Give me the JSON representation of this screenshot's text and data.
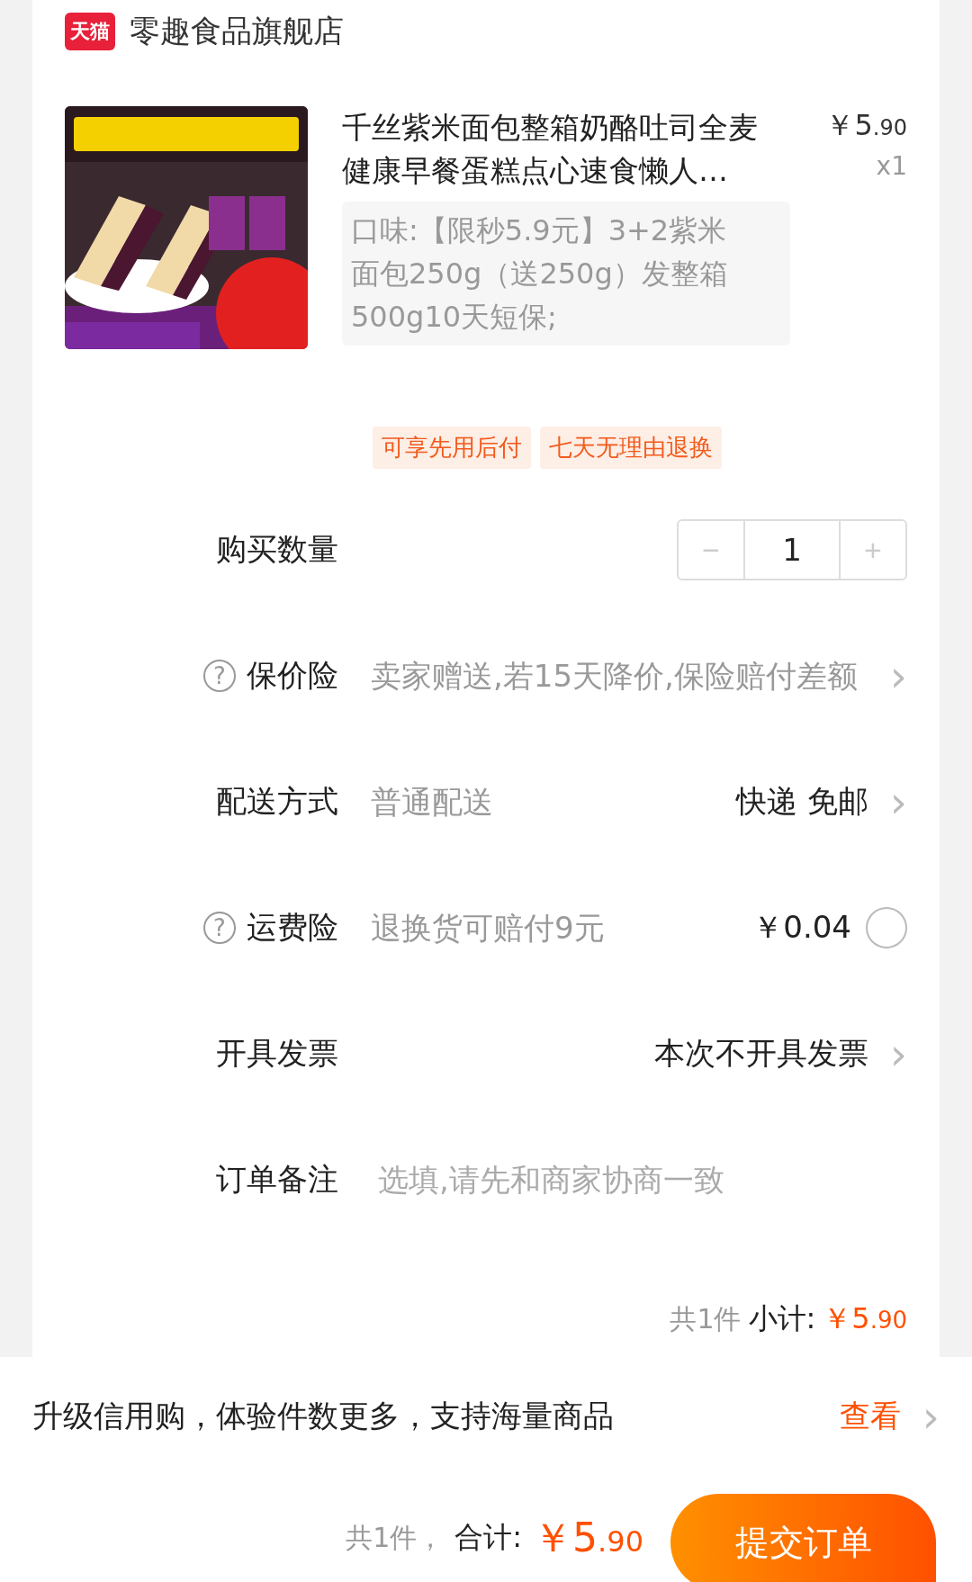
{
  "store": {
    "badge": "天猫",
    "name": "零趣食品旗舰店"
  },
  "product": {
    "title": "千丝紫米面包整箱奶酪吐司全麦健康早餐蛋糕点心速食懒人…",
    "price_symbol": "￥",
    "price_int": "5",
    "price_dec": ".90",
    "quantity": "x1",
    "spec": "口味:【限秒5.9元】3+2紫米面包250g（送250g）发整箱500g10天短保;"
  },
  "tags": [
    "可享先用后付",
    "七天无理由退换"
  ],
  "rows": [
    {
      "kind": "stepper",
      "label": "购买数量",
      "minus": "−",
      "value": "1",
      "plus": "+"
    },
    {
      "kind": "info",
      "help": "?",
      "label": "保价险",
      "desc": "卖家赠送,若15天降价,保险赔付差额",
      "chevron": "›"
    },
    {
      "kind": "choice",
      "label": "配送方式",
      "desc": "普通配送",
      "value": "快递 免邮",
      "chevron": "›"
    },
    {
      "kind": "option",
      "help": "?",
      "label": "运费险",
      "desc": "退换货可赔付9元",
      "value": "￥0.04",
      "checked": false
    },
    {
      "kind": "choice",
      "label": "开具发票",
      "value": "本次不开具发票",
      "chevron": "›"
    },
    {
      "kind": "input",
      "label": "订单备注",
      "placeholder": "选填,请先和商家协商一致"
    }
  ],
  "subtotal": {
    "count": "共1件",
    "label": "小计:",
    "symbol": "￥",
    "int": "5",
    "dec": ".90"
  },
  "promo": {
    "text": "升级信用购，体验件数更多，支持海量商品",
    "link": "查看",
    "chevron": "›"
  },
  "footer": {
    "count": "共1件，",
    "label": "合计:",
    "symbol": "￥",
    "int": "5",
    "dec": ".90",
    "button": "提交订单"
  }
}
